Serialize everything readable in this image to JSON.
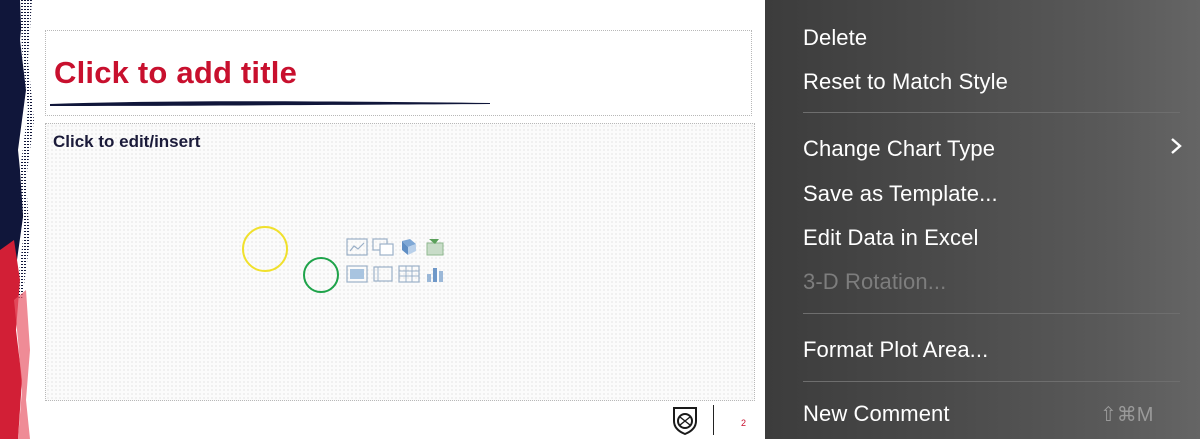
{
  "slide": {
    "title_placeholder": "Click to add title",
    "content_placeholder": "Click to edit/insert",
    "slide_number": "2",
    "insert_icons": [
      "insert-chart-icon",
      "insert-smartart-icon",
      "insert-3d-model-icon",
      "insert-stock-image-icon",
      "insert-picture-icon",
      "insert-video-icon",
      "insert-table-icon",
      "insert-chart-bar-icon"
    ],
    "accent_color": "#c8102e",
    "logo": "little-league-logo"
  },
  "context_menu": {
    "items": [
      {
        "label": "Delete",
        "enabled": true
      },
      {
        "label": "Reset to Match Style",
        "enabled": true
      },
      {
        "label": "Change Chart Type",
        "enabled": true,
        "submenu": true
      },
      {
        "label": "Save as Template...",
        "enabled": true
      },
      {
        "label": "Edit Data in Excel",
        "enabled": true
      },
      {
        "label": "3-D Rotation...",
        "enabled": false
      },
      {
        "label": "Format Plot Area...",
        "enabled": true
      },
      {
        "label": "New Comment",
        "enabled": true,
        "shortcut": "⇧⌘M"
      }
    ]
  },
  "annotations": {
    "yellow_circle_color": "#f0e02c",
    "green_circle_color": "#1ea34a"
  }
}
